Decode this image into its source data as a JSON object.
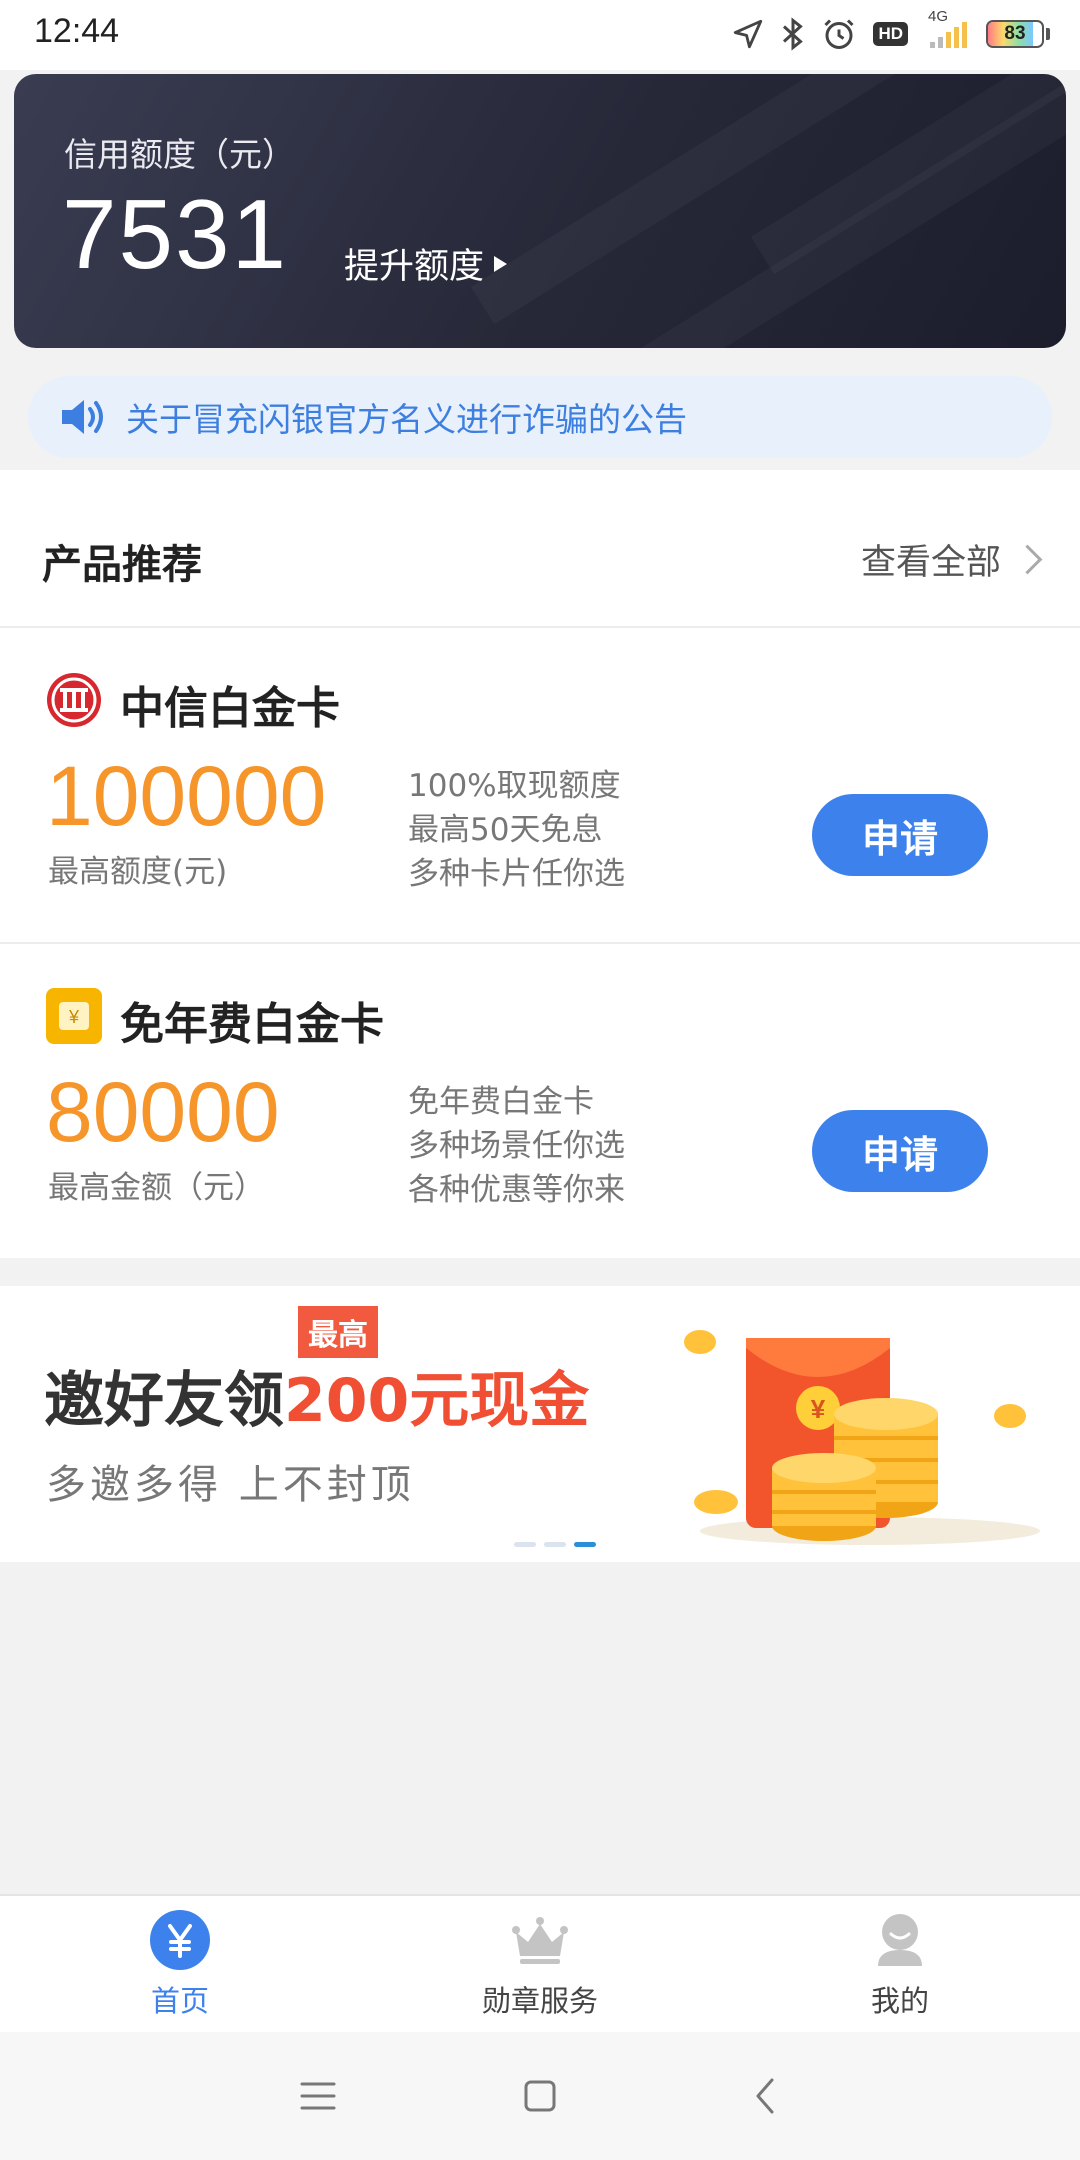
{
  "status_bar": {
    "time": "12:44",
    "network": "4G",
    "battery": "83",
    "battery_level": 0.83
  },
  "credit": {
    "label": "信用额度（元）",
    "amount": "7531",
    "raise_link": "提升额度"
  },
  "notice": {
    "text": "关于冒充闪银官方名义进行诈骗的公告"
  },
  "recommend": {
    "title": "产品推荐",
    "view_all": "查看全部"
  },
  "products": [
    {
      "name": "中信白金卡",
      "amount": "100000",
      "amount_label": "最高额度(元)",
      "features": [
        "100%取现额度",
        "最高50天免息",
        "多种卡片任你选"
      ],
      "button": "申请",
      "logo": "citic-logo",
      "logo_color": "#d7282f"
    },
    {
      "name": "免年费白金卡",
      "amount": "80000",
      "amount_label": "最高金额（元）",
      "features": [
        "免年费白金卡",
        "多种场景任你选",
        "各种优惠等你来"
      ],
      "button": "申请",
      "logo": "yen-card-icon",
      "logo_color": "#f7b500"
    }
  ],
  "banner": {
    "tag": "最高",
    "title_prefix": "邀好友领",
    "title_highlight": "200元现金",
    "subtitle": "多邀多得   上不封顶",
    "page_count": 3,
    "active_page": 3
  },
  "tabs": [
    {
      "label": "首页",
      "icon": "yen-icon",
      "active": true
    },
    {
      "label": "勋章服务",
      "icon": "crown-icon",
      "active": false
    },
    {
      "label": "我的",
      "icon": "user-icon",
      "active": false
    }
  ],
  "colors": {
    "accent": "#3d82ec",
    "amount": "#f5952a",
    "notice": "#3d7fe0",
    "banner_highlight": "#f04f33"
  }
}
